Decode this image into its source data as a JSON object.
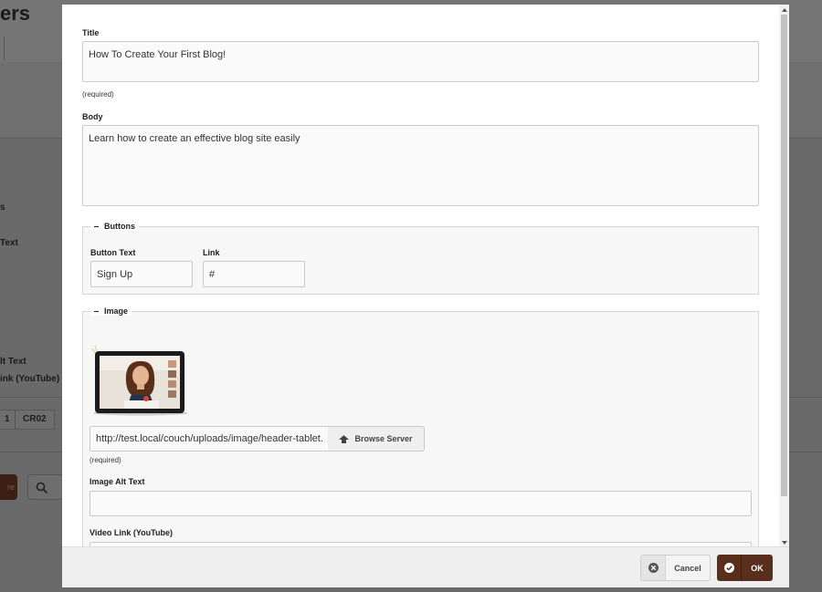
{
  "background": {
    "title_fragment": "ers",
    "labels": [
      "s",
      "Text",
      "lt Text",
      "ink (YouTube)"
    ],
    "chips": [
      "1",
      "CR02"
    ],
    "dark_button_fragment": "re"
  },
  "modal": {
    "title_field": {
      "label": "Title",
      "value": "How To Create Your First Blog!",
      "hint": "(required)"
    },
    "body_field": {
      "label": "Body",
      "value": "Learn how to create an effective blog site easily"
    },
    "buttons_group": {
      "legend": "Buttons",
      "button_text": {
        "label": "Button Text",
        "value": "Sign Up"
      },
      "link": {
        "label": "Link",
        "value": "#"
      }
    },
    "image_group": {
      "legend": "Image",
      "image_path": {
        "value": "http://test.local/couch/uploads/image/header-tablet.pn",
        "hint": "(required)"
      },
      "browse_label": "Browse Server",
      "alt_text": {
        "label": "Image Alt Text",
        "value": ""
      },
      "video_link": {
        "label": "Video Link (YouTube)",
        "value": ""
      }
    },
    "footer": {
      "cancel_label": "Cancel",
      "ok_label": "OK"
    }
  },
  "colors": {
    "accent": "#5a2e1d",
    "overlay": "#6a6a6a"
  },
  "icons": [
    "cancel-icon",
    "check-icon",
    "upload-icon",
    "search-icon"
  ]
}
